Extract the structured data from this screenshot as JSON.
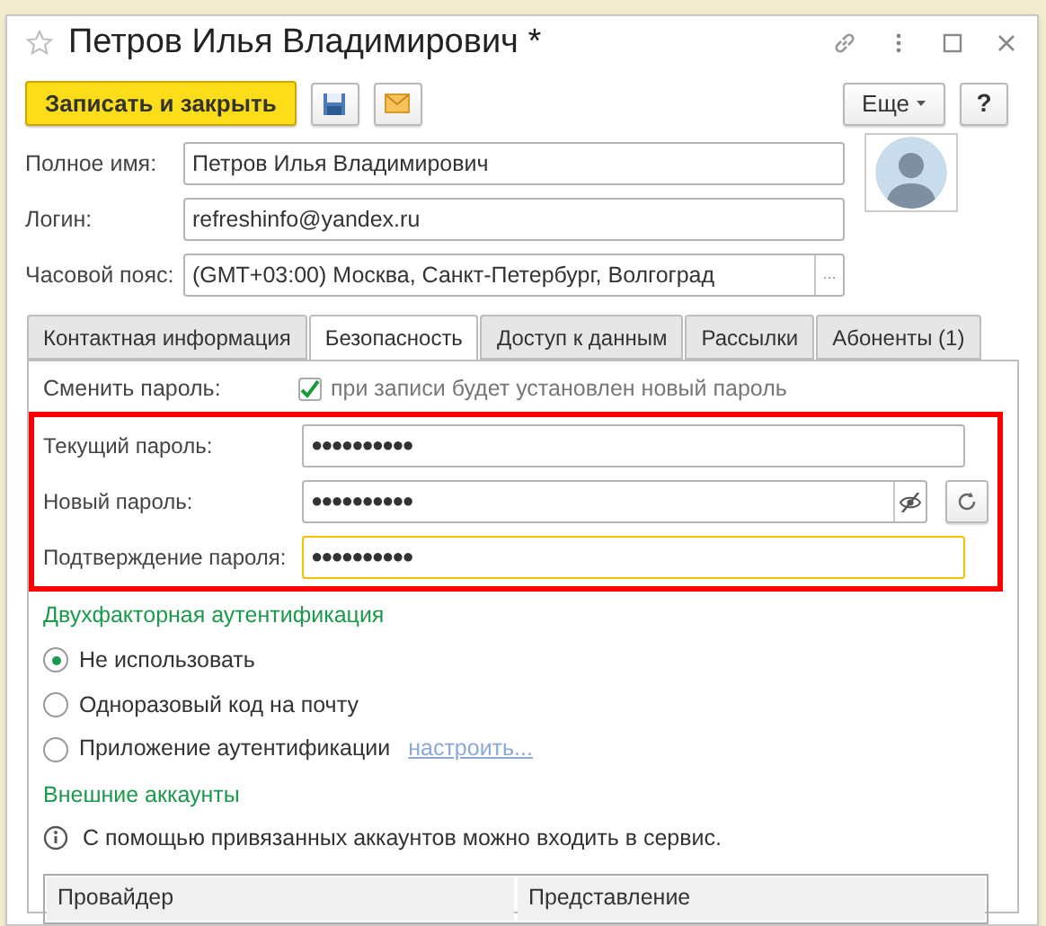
{
  "window": {
    "title": "Петров Илья Владимирович *",
    "favorite": false
  },
  "toolbar": {
    "primary_button": "Записать и закрыть",
    "more_button": "Еще",
    "help_button": "?"
  },
  "fields": [
    {
      "label": "Полное имя:",
      "value": "Петров Илья Владимирович",
      "kind": "text"
    },
    {
      "label": "Логин:",
      "value": "refreshinfo@yandex.ru",
      "kind": "text"
    },
    {
      "label": "Часовой пояс:",
      "value": "(GMT+03:00) Москва, Санкт-Петербург, Волгоград",
      "kind": "choice",
      "choice_button": "..."
    }
  ],
  "tabs": [
    {
      "label": "Контактная информация",
      "selected": false
    },
    {
      "label": "Безопасность",
      "selected": true
    },
    {
      "label": "Доступ к данным",
      "selected": false
    },
    {
      "label": "Рассылки",
      "selected": false
    },
    {
      "label": "Абоненты (1)",
      "selected": false
    }
  ],
  "change_password": {
    "label": "Сменить пароль:",
    "checked": true,
    "text": "при записи будет установлен новый пароль"
  },
  "password_fields": [
    {
      "label": "Текущий пароль:",
      "value": "●●●●●●●●●●",
      "kind": "plain",
      "focused": false
    },
    {
      "label": "Новый пароль:",
      "value": "●●●●●●●●●●",
      "kind": "generate",
      "focused": false
    },
    {
      "label": "Подтверждение пароля:",
      "value": "●●●●●●●●●●",
      "kind": "plain",
      "focused": true
    }
  ],
  "two_factor": {
    "heading": "Двухфакторная аутентификация",
    "options": [
      {
        "label": "Не использовать",
        "selected": true
      },
      {
        "label": "Одноразовый код на почту",
        "selected": false
      },
      {
        "label": "Приложение аутентификации",
        "selected": false,
        "link": "настроить..."
      }
    ]
  },
  "external_accounts": {
    "heading": "Внешние аккаунты",
    "info": "С помощью привязанных аккаунтов можно входить в сервис.",
    "table": {
      "columns": [
        "Провайдер",
        "Представление"
      ]
    }
  }
}
